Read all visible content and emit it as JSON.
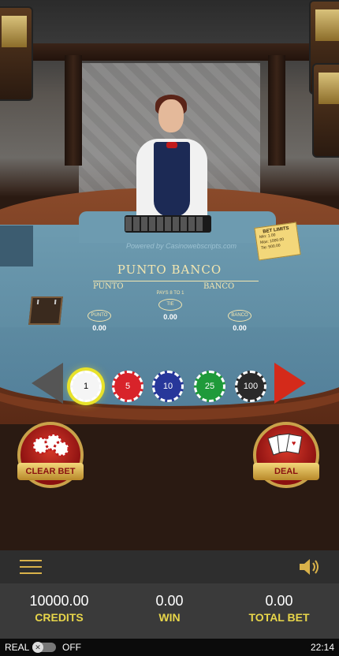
{
  "table": {
    "powered_by": "Powered by Casinowebscripts.com",
    "title": "PUNTO BANCO",
    "punto_label": "PUNTO",
    "banco_label": "BANCO",
    "tie_pays": "PAYS 8 TO 1",
    "tie_label": "TIE",
    "punto_spot": "PUNTO",
    "banco_spot": "BANCO",
    "punto_bet": "0.00",
    "tie_bet": "0.00",
    "banco_bet": "0.00"
  },
  "limits": {
    "title": "BET LIMITS",
    "min": "Min: 1.00",
    "max": "Max: 1000.00",
    "tie": "Tie: 500.00"
  },
  "chips": [
    {
      "label": "1",
      "color": "#f5f5f5",
      "selected": true
    },
    {
      "label": "5",
      "color": "#d8232a",
      "selected": false
    },
    {
      "label": "10",
      "color": "#27379a",
      "selected": false
    },
    {
      "label": "25",
      "color": "#1f9a3a",
      "selected": false
    },
    {
      "label": "100",
      "color": "#2a2a2a",
      "selected": false
    }
  ],
  "buttons": {
    "clear_bet": "CLEAR BET",
    "deal": "DEAL"
  },
  "stats": {
    "credits_value": "10000.00",
    "credits_label": "CREDITS",
    "win_value": "0.00",
    "win_label": "WIN",
    "total_bet_value": "0.00",
    "total_bet_label": "TOTAL BET"
  },
  "status_bar": {
    "real_label": "REAL",
    "off_label": "OFF",
    "time": "22:14"
  },
  "icons": [
    "menu-icon",
    "sound-icon",
    "chevron-left-icon",
    "chevron-right-icon",
    "chips-icon",
    "cards-icon",
    "close-icon"
  ]
}
